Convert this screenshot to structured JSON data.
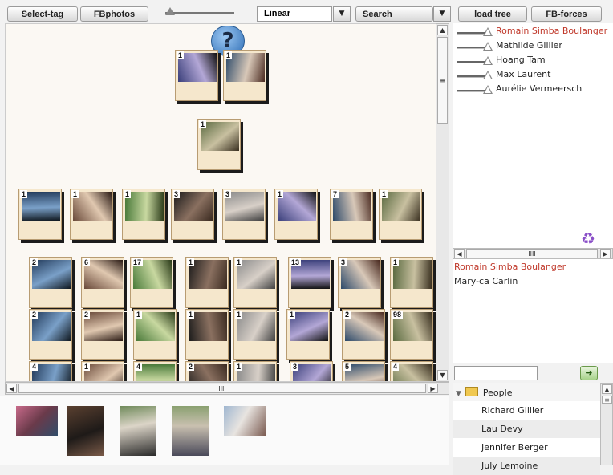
{
  "toolbar": {
    "select_tag": "Select-tag",
    "fbphotos": "FBphotos",
    "layout_value": "Linear",
    "search": "Search",
    "load_tree": "load tree",
    "fb_forces": "FB-forces",
    "dropdown_glyph": "▼",
    "help_glyph": "?"
  },
  "tree": {
    "level1": [
      {
        "count": "1"
      },
      {
        "count": "1"
      }
    ],
    "level2": [
      {
        "count": "1"
      }
    ],
    "level3": [
      {
        "count": "1"
      },
      {
        "count": "1"
      },
      {
        "count": "1"
      },
      {
        "count": "3"
      },
      {
        "count": "3"
      },
      {
        "count": "1"
      },
      {
        "count": "7"
      },
      {
        "count": "1"
      }
    ],
    "row4": [
      {
        "count": "2"
      },
      {
        "count": "6"
      },
      {
        "count": "17"
      },
      {
        "count": "1"
      },
      {
        "count": "1"
      },
      {
        "count": "13"
      },
      {
        "count": "3"
      },
      {
        "count": "1"
      }
    ],
    "row5": [
      {
        "count": "2"
      },
      {
        "count": "2"
      },
      {
        "count": "1"
      },
      {
        "count": "1"
      },
      {
        "count": "1"
      },
      {
        "count": "1"
      },
      {
        "count": "2"
      },
      {
        "count": "98"
      }
    ],
    "row6": [
      {
        "count": "4"
      },
      {
        "count": "1"
      },
      {
        "count": "4"
      },
      {
        "count": "2"
      },
      {
        "count": "1"
      },
      {
        "count": "3"
      },
      {
        "count": "5"
      },
      {
        "count": "4"
      }
    ]
  },
  "forces": [
    {
      "name": "Romain Simba Boulanger",
      "color": "#c0392b"
    },
    {
      "name": "Mathilde Gillier",
      "color": "#222222"
    },
    {
      "name": "Hoang Tam",
      "color": "#222222"
    },
    {
      "name": "Max Laurent",
      "color": "#222222"
    },
    {
      "name": "Aurélie Vermeersch",
      "color": "#222222"
    }
  ],
  "selected_people": [
    {
      "name": "Romain Simba Boulanger",
      "color": "#c0392b"
    },
    {
      "name": "Mary-ca Carlin",
      "color": "#222222"
    }
  ],
  "people_tree": {
    "root": "People",
    "items": [
      "Richard Gillier",
      "Lau Devy",
      "Jennifer Berger",
      "July Lemoine"
    ]
  },
  "scroll": {
    "grip": "IIII",
    "vgrip": "≡",
    "up": "▲",
    "down": "▼",
    "left": "◀",
    "right": "▶"
  },
  "recycle_glyph": "♻",
  "add_glyph": "➜"
}
